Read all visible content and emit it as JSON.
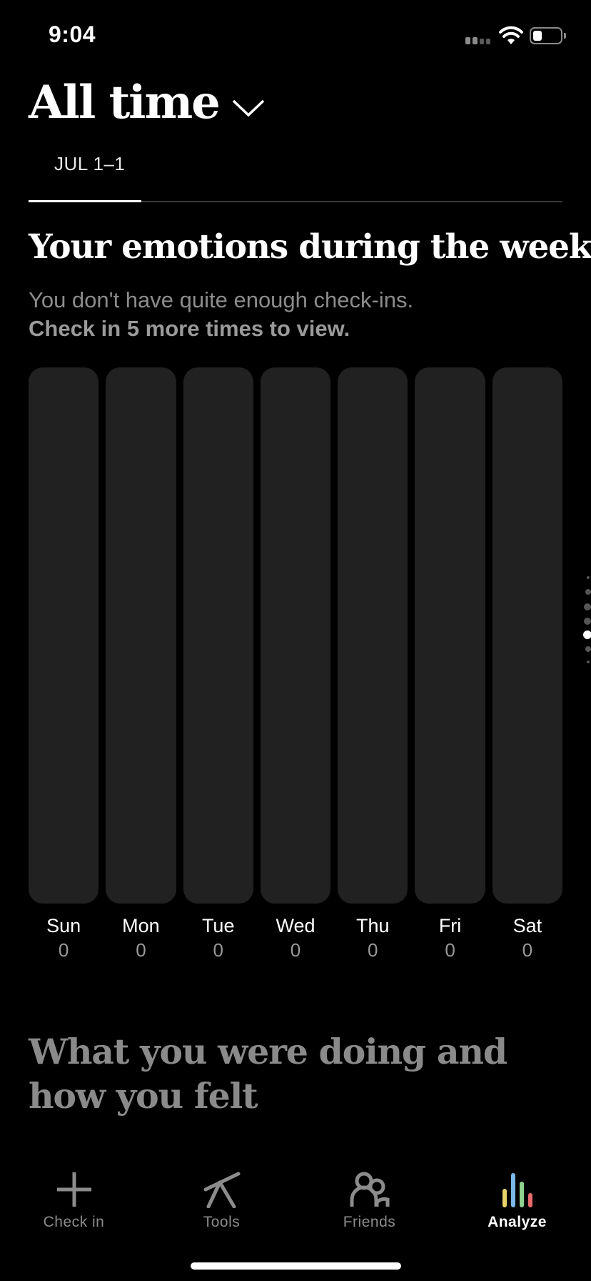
{
  "status": {
    "time": "9:04"
  },
  "header": {
    "range_label": "All time",
    "date_tab": "JUL 1–1"
  },
  "section": {
    "title": "Your emotions during the week",
    "notice": "You don't have quite enough check-ins.",
    "notice_bold": "Check in 5 more times to view."
  },
  "chart_data": {
    "type": "bar",
    "categories": [
      "Sun",
      "Mon",
      "Tue",
      "Wed",
      "Thu",
      "Fri",
      "Sat"
    ],
    "values": [
      0,
      0,
      0,
      0,
      0,
      0,
      0
    ]
  },
  "section2": {
    "title": "What you were doing and how you felt"
  },
  "nav": {
    "items": [
      {
        "label": "Check in",
        "icon": "plus-icon"
      },
      {
        "label": "Tools",
        "icon": "tools-icon"
      },
      {
        "label": "Friends",
        "icon": "friends-icon"
      },
      {
        "label": "Analyze",
        "icon": "analyze-icon"
      }
    ],
    "active": "Analyze"
  },
  "colors": {
    "background": "#000000",
    "bar": "#212121",
    "muted_text": "#8c8c8c",
    "analyze_bars": [
      "#e8d36a",
      "#7ab8e8",
      "#8fd18f",
      "#e86b6b"
    ]
  }
}
